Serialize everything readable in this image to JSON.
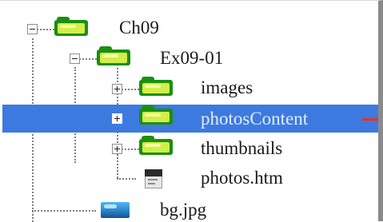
{
  "tree": {
    "items": [
      {
        "label": "Ch09",
        "toggle": "collapse",
        "icon": "folder-icon"
      },
      {
        "label": "Ex09-01",
        "toggle": "collapse",
        "icon": "folder-icon"
      },
      {
        "label": "images",
        "toggle": "expand",
        "icon": "folder-icon"
      },
      {
        "label": "photosContent",
        "toggle": "expand",
        "icon": "folder-icon",
        "selected": true
      },
      {
        "label": "thumbnails",
        "toggle": "expand",
        "icon": "folder-icon"
      },
      {
        "label": "photos.htm",
        "icon": "html-file-icon"
      },
      {
        "label": "bg.jpg",
        "icon": "image-file-icon"
      }
    ]
  },
  "colors": {
    "selection": "#3d7ae0",
    "folder_dark": "#1b8f10",
    "folder_light": "#d2ee4a",
    "selected_text": "#e3ecff",
    "marker": "#e8321e"
  }
}
